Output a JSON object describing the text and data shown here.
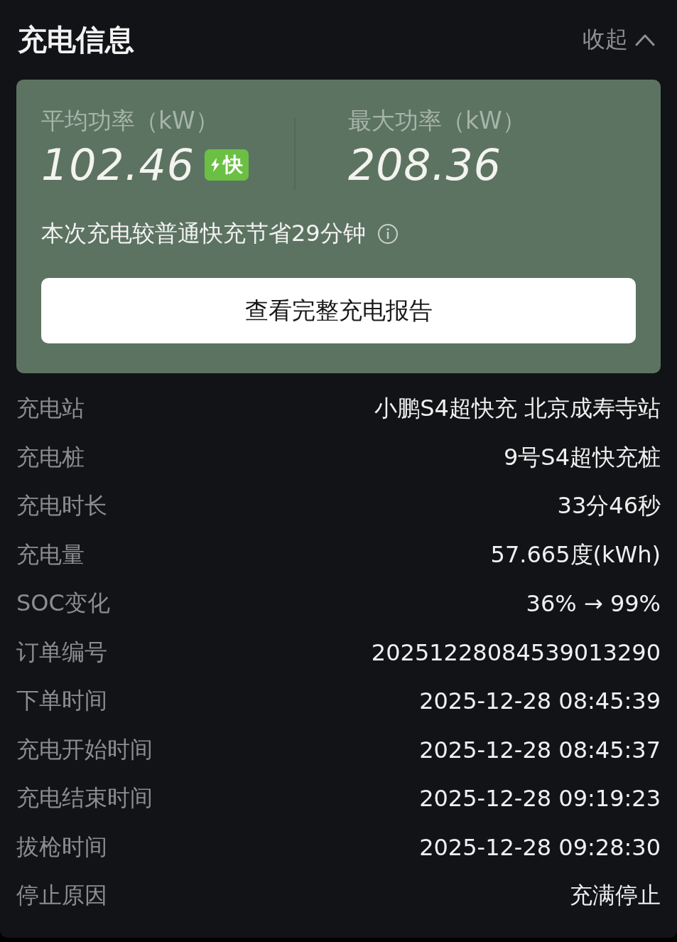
{
  "header": {
    "title": "充电信息",
    "toggle": {
      "label": "收起",
      "expanded": true
    }
  },
  "summary": {
    "stats": [
      {
        "label": "平均功率（kW）",
        "value": "102.46",
        "badge": "快"
      },
      {
        "label": "最大功率（kW）",
        "value": "208.36"
      }
    ],
    "note": "本次充电较普通快充节省29分钟",
    "button": "查看完整充电报告"
  },
  "details": [
    {
      "label": "充电站",
      "value": "小鹏S4超快充 北京成寿寺站"
    },
    {
      "label": "充电桩",
      "value": "9号S4超快充桩"
    },
    {
      "label": "充电时长",
      "value": "33分46秒"
    },
    {
      "label": "充电量",
      "value": "57.665度(kWh)"
    },
    {
      "label": "SOC变化",
      "value": "36% → 99%"
    },
    {
      "label": "订单编号",
      "value": "20251228084539013290"
    },
    {
      "label": "下单时间",
      "value": "2025-12-28 08:45:39"
    },
    {
      "label": "充电开始时间",
      "value": "2025-12-28 08:45:37"
    },
    {
      "label": "充电结束时间",
      "value": "2025-12-28 09:19:23"
    },
    {
      "label": "拔枪时间",
      "value": "2025-12-28 09:28:30"
    },
    {
      "label": "停止原因",
      "value": "充满停止"
    }
  ]
}
